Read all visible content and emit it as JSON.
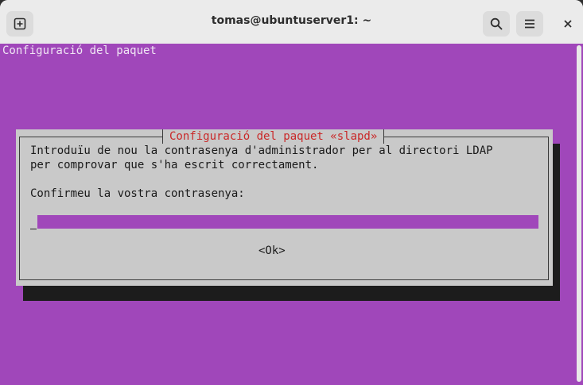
{
  "window": {
    "title": "tomas@ubuntuserver1: ~",
    "icons": {
      "new_tab": "new-tab-icon",
      "search": "search-icon",
      "menu": "hamburger-menu-icon",
      "close": "close-icon"
    }
  },
  "terminal": {
    "background_color": "#a047ba",
    "backtitle": "Configuració del paquet"
  },
  "dialog": {
    "title": "Configuració del paquet «slapd»",
    "line1": "Introduïu de nou la contrasenya d'administrador per al directori LDAP",
    "line2": "per comprovar que s'ha escrit correctament.",
    "prompt": "Confirmeu la vostra contrasenya:",
    "password_value": "",
    "ok_label": "<Ok>",
    "title_color": "#c92828"
  }
}
